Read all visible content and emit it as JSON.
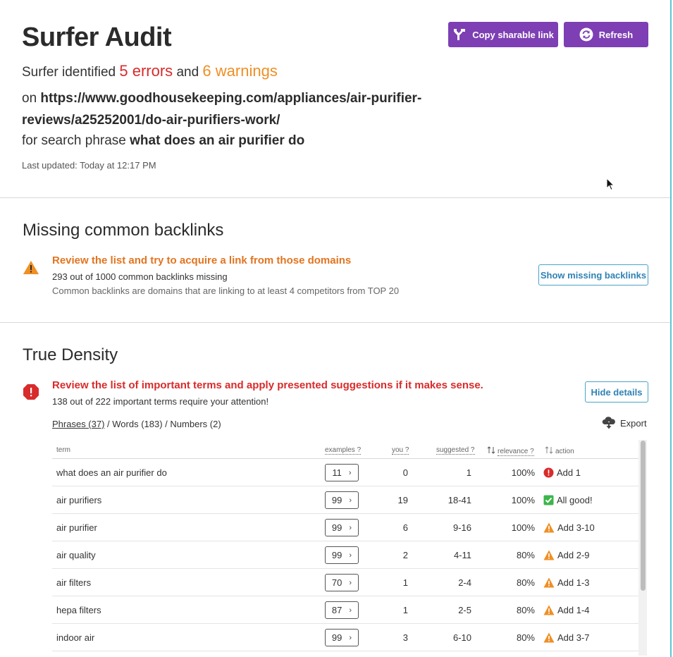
{
  "header": {
    "title": "Surfer Audit",
    "identified_prefix": "Surfer identified",
    "errors_text": "5 errors",
    "and_text": "and",
    "warnings_text": "6 warnings",
    "on_text": "on",
    "url": "https://www.goodhousekeeping.com/appliances/air-purifier-reviews/a25252001/do-air-purifiers-work/",
    "search_prefix": "for search phrase",
    "search_phrase": "what does an air purifier do",
    "last_updated": "Last updated: Today at 12:17 PM",
    "copy_link_label": "Copy sharable link",
    "refresh_label": "Refresh"
  },
  "backlinks": {
    "title": "Missing common backlinks",
    "headline": "Review the list and try to acquire a link from those domains",
    "summary": "293 out of 1000 common backlinks missing",
    "description": "Common backlinks are domains that are linking to at least 4 competitors from TOP 20",
    "button_label": "Show missing backlinks"
  },
  "density": {
    "title": "True Density",
    "headline": "Review the list of important terms and apply presented suggestions if it makes sense.",
    "summary": "138 out of 222 important terms require your attention!",
    "hide_label": "Hide details",
    "tabs": [
      "Phrases (37)",
      "Words (183)",
      "Numbers (2)"
    ],
    "tab_separator": " / ",
    "export_label": "Export",
    "columns": {
      "term": "term",
      "examples": "examples ?",
      "you": "you ?",
      "suggested": "suggested ?",
      "relevance": "relevance ?",
      "action": "action"
    },
    "rows": [
      {
        "term": "what does an air purifier do",
        "examples": "11",
        "you": "0",
        "suggested": "1",
        "relevance": "100%",
        "status": "error",
        "action": "Add 1"
      },
      {
        "term": "air purifiers",
        "examples": "99",
        "you": "19",
        "suggested": "18-41",
        "relevance": "100%",
        "status": "good",
        "action": "All good!"
      },
      {
        "term": "air purifier",
        "examples": "99",
        "you": "6",
        "suggested": "9-16",
        "relevance": "100%",
        "status": "warning",
        "action": "Add 3-10"
      },
      {
        "term": "air quality",
        "examples": "99",
        "you": "2",
        "suggested": "4-11",
        "relevance": "80%",
        "status": "warning",
        "action": "Add 2-9"
      },
      {
        "term": "air filters",
        "examples": "70",
        "you": "1",
        "suggested": "2-4",
        "relevance": "80%",
        "status": "warning",
        "action": "Add 1-3"
      },
      {
        "term": "hepa filters",
        "examples": "87",
        "you": "1",
        "suggested": "2-5",
        "relevance": "80%",
        "status": "warning",
        "action": "Add 1-4"
      },
      {
        "term": "indoor air",
        "examples": "99",
        "you": "3",
        "suggested": "6-10",
        "relevance": "80%",
        "status": "warning",
        "action": "Add 3-7"
      }
    ]
  },
  "colors": {
    "accent_purple": "#7d3fb3",
    "error_red": "#d92b2b",
    "warning_orange": "#ef8f24",
    "good_green": "#3db54a",
    "link_blue": "#2f82b4"
  }
}
